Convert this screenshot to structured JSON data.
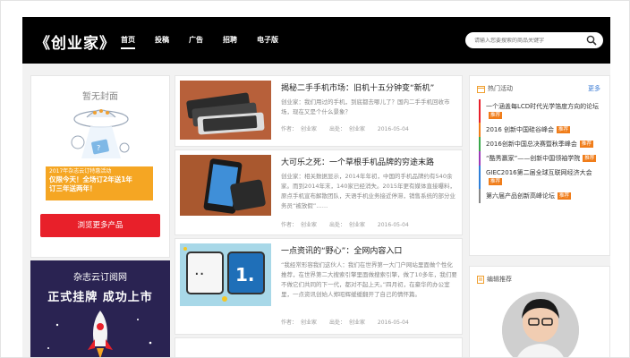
{
  "header": {
    "logo": "《创业家》",
    "nav": [
      "首页",
      "投稿",
      "广告",
      "招聘",
      "电子版"
    ],
    "search_placeholder": "请输入您要搜索的商品关键字"
  },
  "cover": {
    "title": "暂无封面",
    "promo_line1": "2017年杂志云订特惠活动",
    "promo_line2": "仅限今天！全场订2年送1年",
    "promo_line3": "订三年送两年！",
    "button": "浏览更多产品"
  },
  "banner": {
    "sub": "杂志云订阅网",
    "big": "正式挂牌  成功上市"
  },
  "articles": [
    {
      "title": "揭秘二手手机市场：旧机十五分钟变“新机”",
      "excerpt": "创业家：我们用过的手机，到底都去哪儿了？国内二手手机回收市场，现在又是个什么景象？",
      "author_label": "作者：",
      "author": "创业家",
      "source_label": "出处：",
      "source": "创业家",
      "date": "2016-05-04"
    },
    {
      "title": "大可乐之死：一个草根手机品牌的穷途末路",
      "excerpt": "创业家：相关数据显示，2014年年初，中国的手机品牌约有540余家。而到2014年末，140家已经消失。2015年更有媒体直接曝料，原点手机宣布解散团队，天语手机业务接近停滞，销售系统的部分业务员“被放假”……",
      "author_label": "作者：",
      "author": "创业家",
      "source_label": "出处：",
      "source": "创业家",
      "date": "2016-05-04"
    },
    {
      "title": "一点资讯的“野心”：全网内容入口",
      "excerpt": "“我经常形容我们这伙人：我们在世界第一大门户网站里面做个性化推荐，在世界第二大搜索引擎里面做搜索引擎，做了10多年，我们要不做它们共同的下一代，都对不起上天。”四月初，在豪华的办公室里，一点资讯创始人郑昭辉缓缓翻开了自己的情怀篇。",
      "author_label": "作者：",
      "author": "创业家",
      "source_label": "出处：",
      "source": "创业家",
      "date": "2016-05-04"
    }
  ],
  "hot": {
    "title": "热门活动",
    "more": "更多",
    "items": [
      {
        "text": "一个涵盖每LCD时代光学箔度方向的论坛",
        "tag": "推荐"
      },
      {
        "text": "2016 创新中国硅谷峰会",
        "tag": "推荐"
      },
      {
        "text": "2016创新中国总决赛暨秋季峰会",
        "tag": "推荐"
      },
      {
        "text": "“酷秀赢家”——创新中国领袖学院",
        "tag": "推荐"
      },
      {
        "text": "GIEC2016第二届全球互联网经济大会",
        "tag": "推荐"
      },
      {
        "text": "第六届产品创新高峰论坛",
        "tag": "推荐"
      }
    ]
  },
  "editor": {
    "title": "编辑推荐"
  }
}
